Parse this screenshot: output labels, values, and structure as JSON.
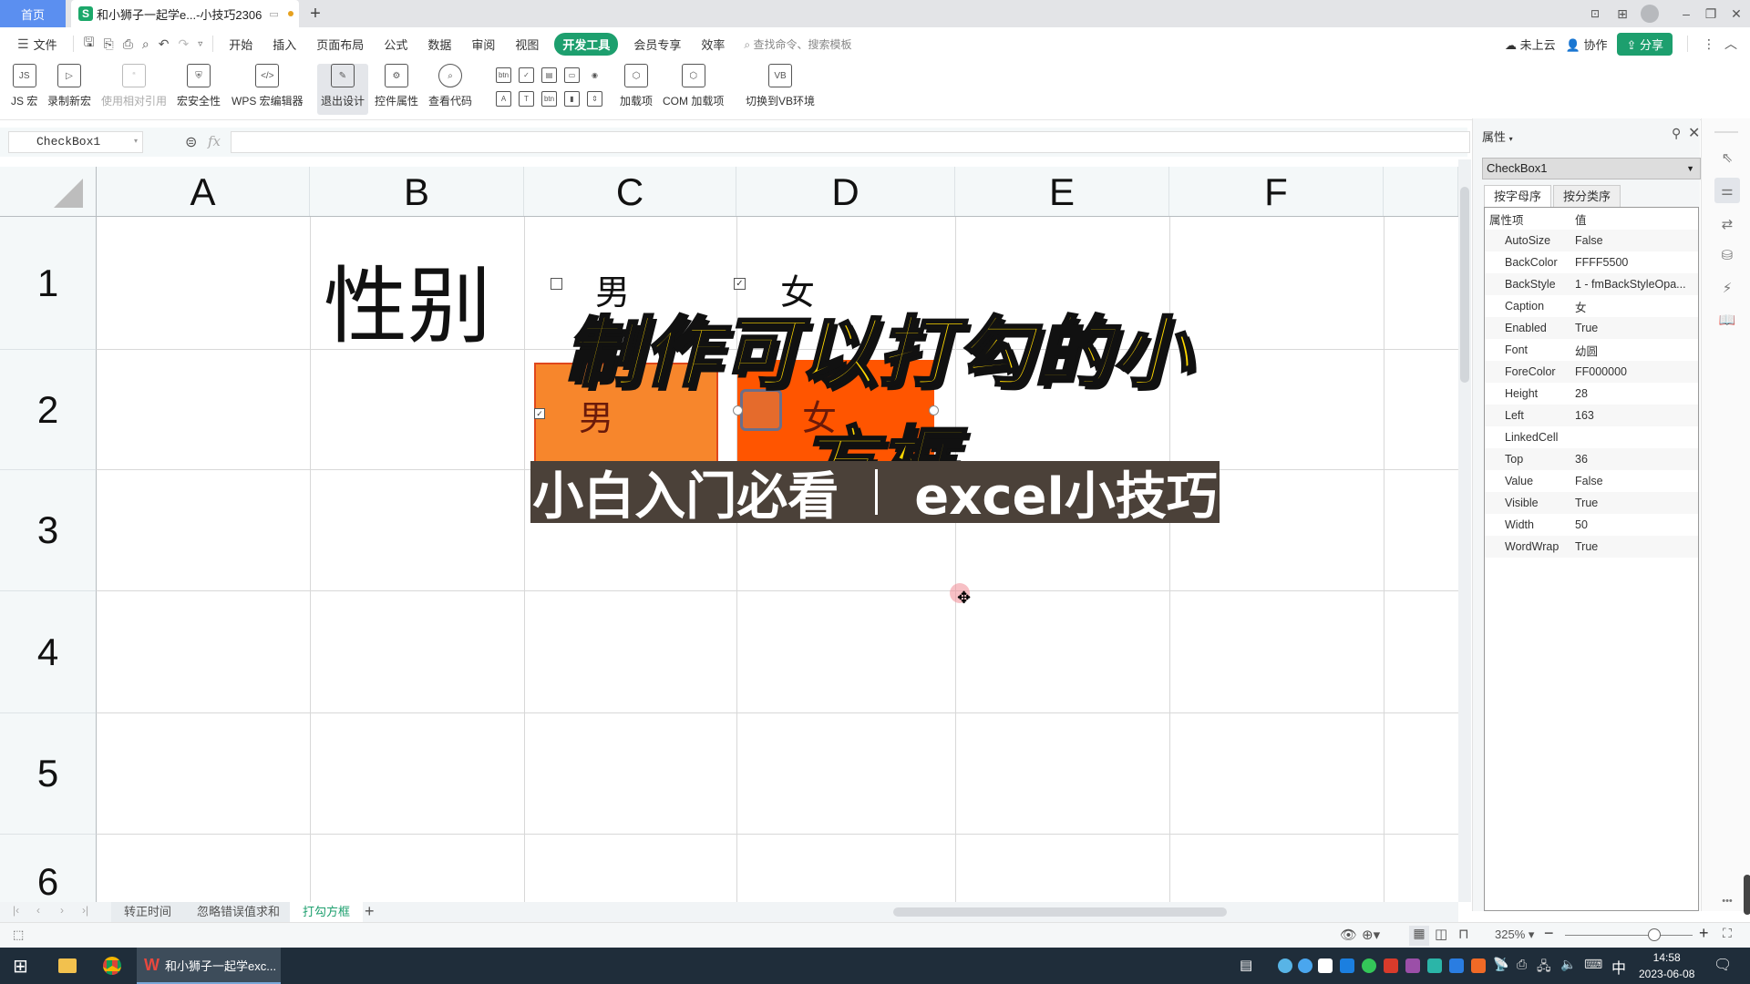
{
  "titlebar": {
    "home_tab": "首页",
    "doc_tab": "和小狮子一起学e...-小技巧2306",
    "doc_icon": "S",
    "new_tab": "+",
    "controls": [
      "minimize-icon",
      "restore-icon",
      "close-icon"
    ]
  },
  "menubar": {
    "file": "文件",
    "items": [
      "开始",
      "插入",
      "页面布局",
      "公式",
      "数据",
      "审阅",
      "视图",
      "开发工具",
      "会员专享",
      "效率"
    ],
    "active": "开发工具",
    "search_placeholder": "查找命令、搜索模板",
    "cloud": "未上云",
    "collab": "协作",
    "share": "分享"
  },
  "ribbon": {
    "buttons": [
      {
        "label": "JS 宏",
        "icon": "JS"
      },
      {
        "label": "录制新宏",
        "icon": "▷"
      },
      {
        "label": "使用相对引用",
        "icon": "“",
        "disabled": true
      },
      {
        "label": "宏安全性",
        "icon": "⛨"
      },
      {
        "label": "WPS 宏编辑器",
        "icon": "</>"
      },
      {
        "label": "退出设计",
        "icon": "✎",
        "selected": true
      },
      {
        "label": "控件属性",
        "icon": "⚙"
      },
      {
        "label": "查看代码",
        "icon": "⌕"
      },
      {
        "label": "加载项",
        "icon": "⬡"
      },
      {
        "label": "COM 加载项",
        "icon": "⬡"
      },
      {
        "label": "切换到VB环境",
        "icon": "VB"
      }
    ],
    "controls_row1": [
      "btn",
      "✓",
      "▤",
      "▭",
      "◉"
    ],
    "controls_row2": [
      "A",
      "T",
      "btn",
      "▮",
      "⇕"
    ]
  },
  "formula_bar": {
    "name_box": "CheckBox1",
    "fx": "fx",
    "value": ""
  },
  "sheet": {
    "columns": [
      "A",
      "B",
      "C",
      "D",
      "E",
      "F"
    ],
    "rows": [
      "1",
      "2",
      "3",
      "4",
      "5",
      "6"
    ],
    "b1": "性别",
    "row1_checkboxes": [
      {
        "label": "男",
        "checked": false,
        "mark": ""
      },
      {
        "label": "女",
        "checked": true,
        "mark": "✓"
      }
    ],
    "row2_checkboxes": [
      {
        "label": "男",
        "checked": true,
        "mark": "✓",
        "backcolor": "#f7862c"
      },
      {
        "label": "女",
        "checked": false,
        "mark": "",
        "backcolor": "#ff5500"
      }
    ]
  },
  "overlay": {
    "title": "制作可以打勾的小方框",
    "subtitle_left": "小白入门必看",
    "subtitle_right": "excel小技巧"
  },
  "properties": {
    "title": "属性",
    "object": "CheckBox1",
    "tabs": [
      "按字母序",
      "按分类序"
    ],
    "header": {
      "key": "属性项",
      "value": "值"
    },
    "rows": [
      {
        "key": "AutoSize",
        "value": "False"
      },
      {
        "key": "BackColor",
        "value": "FFFF5500"
      },
      {
        "key": "BackStyle",
        "value": "1 - fmBackStyleOpa..."
      },
      {
        "key": "Caption",
        "value": "女"
      },
      {
        "key": "Enabled",
        "value": "True"
      },
      {
        "key": "Font",
        "value": "幼圆"
      },
      {
        "key": "ForeColor",
        "value": "FF000000"
      },
      {
        "key": "Height",
        "value": "28"
      },
      {
        "key": "Left",
        "value": "163"
      },
      {
        "key": "LinkedCell",
        "value": ""
      },
      {
        "key": "Top",
        "value": "36"
      },
      {
        "key": "Value",
        "value": "False"
      },
      {
        "key": "Visible",
        "value": "True"
      },
      {
        "key": "Width",
        "value": "50"
      },
      {
        "key": "WordWrap",
        "value": "True"
      }
    ]
  },
  "sheet_tabs": {
    "tabs": [
      "转正时间",
      "忽略错误值求和",
      "打勾方框"
    ],
    "active": "打勾方框",
    "add": "+"
  },
  "status": {
    "zoom": "325%",
    "zoom_fraction": 0.7
  },
  "taskbar": {
    "app_label": "和小狮子一起学exc...",
    "ime": "中",
    "time": "14:58",
    "date": "2023-06-08"
  }
}
